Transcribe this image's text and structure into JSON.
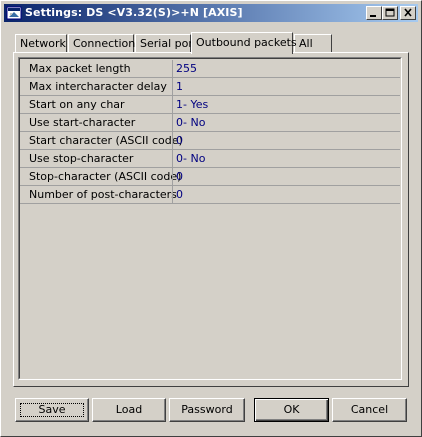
{
  "window": {
    "title": "Settings: DS  <V3.32(S)>+N [AXIS]"
  },
  "tabs": [
    {
      "label": "Network",
      "active": false
    },
    {
      "label": "Connection",
      "active": false
    },
    {
      "label": "Serial port",
      "active": false
    },
    {
      "label": "Outbound packets",
      "active": true
    },
    {
      "label": "All",
      "active": false
    }
  ],
  "properties": [
    {
      "name": "Max packet length",
      "value": "255"
    },
    {
      "name": "Max intercharacter delay",
      "value": "1"
    },
    {
      "name": "Start on any char",
      "value": "1- Yes"
    },
    {
      "name": "Use start-character",
      "value": "0- No"
    },
    {
      "name": "Start character (ASCII code)",
      "value": "0"
    },
    {
      "name": "Use stop-character",
      "value": "0- No"
    },
    {
      "name": "Stop-character (ASCII code)",
      "value": "0"
    },
    {
      "name": "Number of post-characters",
      "value": "0"
    }
  ],
  "buttons": {
    "save": "Save",
    "load": "Load",
    "password": "Password",
    "ok": "OK",
    "cancel": "Cancel"
  },
  "colors": {
    "titlebar_start": "#0a246a",
    "titlebar_end": "#a6caf0",
    "value_text": "#000080",
    "face": "#d4d0c8"
  },
  "icons": {
    "app": "settings-app-icon",
    "minimize": "minimize-icon",
    "maximize": "maximize-icon",
    "close": "close-icon"
  }
}
